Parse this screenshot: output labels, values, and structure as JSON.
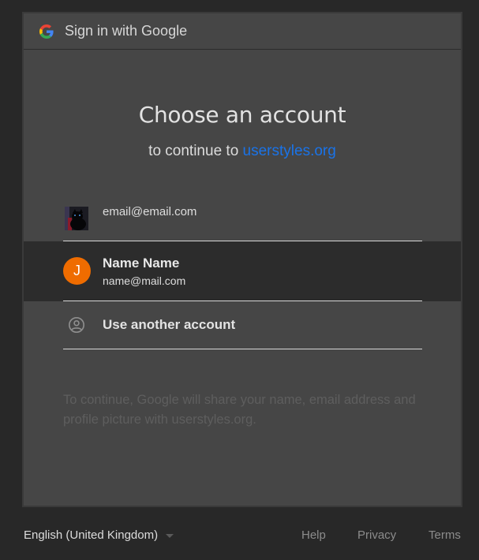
{
  "header": {
    "title": "Sign in with Google",
    "logo_icon": "google-g-icon"
  },
  "main": {
    "heading": "Choose an account",
    "subheading_prefix": "to continue to ",
    "site_link": "userstyles.org"
  },
  "accounts": [
    {
      "email": "email@email.com",
      "avatar": "cat-photo"
    },
    {
      "name": "Name Name",
      "email": "name@mail.com",
      "avatar_letter": "J",
      "avatar_color": "#ef6c00",
      "selected": true
    }
  ],
  "use_another": {
    "label": "Use another account",
    "icon": "account-circle-icon"
  },
  "disclaimer": "To continue, Google will share your name, email address and profile picture with userstyles.org.",
  "footer": {
    "language": "English (United Kingdom)",
    "help": "Help",
    "privacy": "Privacy",
    "terms": "Terms"
  },
  "colors": {
    "link": "#1a73e8",
    "page_bg": "#282828",
    "card_bg": "#464646",
    "selected_row_bg": "#2c2c2c"
  }
}
